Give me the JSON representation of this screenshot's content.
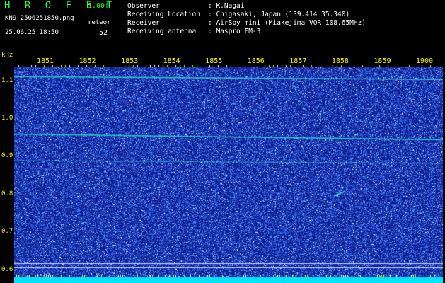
{
  "header": {
    "app_title": "H R O F F T",
    "version": "1.00f",
    "filename": "KN9_2506251850.png",
    "datetime": "25.06.25 18:50",
    "meteor_label": "meteor",
    "meteor_count": "52"
  },
  "info": [
    {
      "key": "Observer",
      "value": ": K.Nagai"
    },
    {
      "key": "Receiving Location",
      "value": ": Chigasaki, Japan (139.414 35.340)"
    },
    {
      "key": "Receiver",
      "value": ": AirSpy mini (Miakejima VOR 108.65MHz)"
    },
    {
      "key": "Receiving antenna",
      "value": ": Maspro FM-3"
    }
  ],
  "chart_data": {
    "type": "heatmap",
    "ylabel": "kHz",
    "y_unit": "kHz",
    "x_ticks": [
      "1851",
      "1852",
      "1853",
      "1854",
      "1855",
      "1856",
      "1857",
      "1858",
      "1859",
      "1900"
    ],
    "y_ticks": [
      "1.1",
      "1.0",
      "0.9",
      "0.8",
      "0.7",
      "0.6"
    ],
    "ylim": [
      0.575,
      1.165
    ],
    "carrier_lines_khz": [
      1.11,
      0.958,
      0.888
    ],
    "reference_lines_khz": [
      0.617,
      0.605
    ],
    "colors": {
      "background": "#101c8c",
      "noise": "#3a7cff",
      "carrier": "#30e0d0",
      "bottom_band": "#00e5ff"
    }
  }
}
